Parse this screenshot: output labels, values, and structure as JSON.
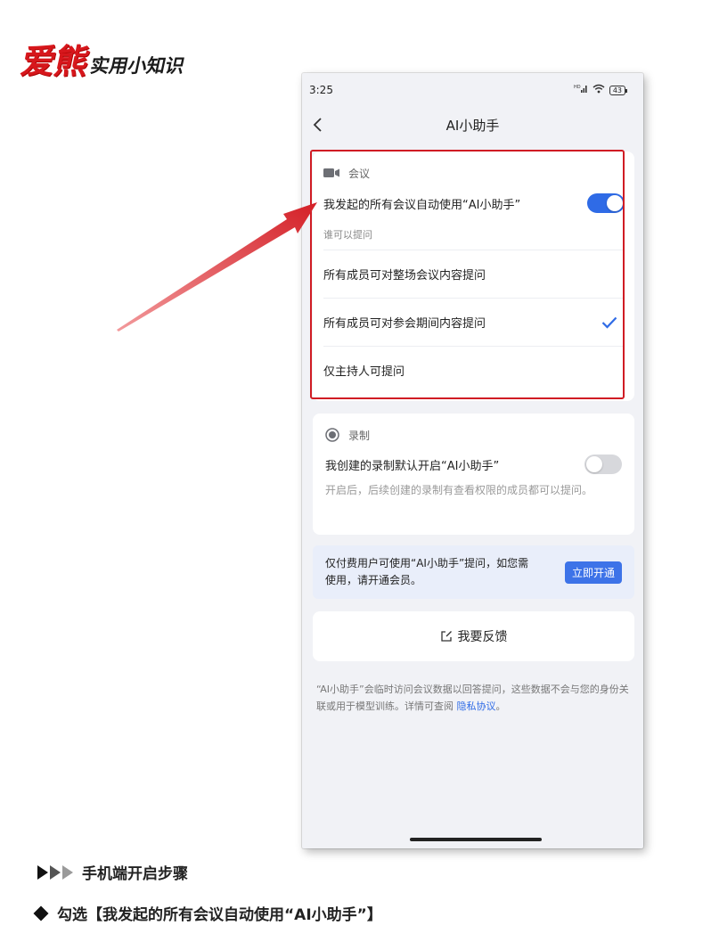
{
  "brand": {
    "main": "爱熊",
    "sub": "实用小知识",
    "accent": "#d7171c"
  },
  "phone": {
    "status_bar": {
      "time": "3:25",
      "signal_label": "HD",
      "battery": "43"
    },
    "nav": {
      "title": "AI小助手",
      "back_icon": "chevron-left-icon"
    },
    "meeting": {
      "section_label": "会议",
      "section_icon": "video-camera-icon",
      "toggle_label": "我发起的所有会议自动使用“AI小助手”",
      "toggle_on": true,
      "question_header": "谁可以提问",
      "options": [
        {
          "label": "所有成员可对整场会议内容提问",
          "selected": false
        },
        {
          "label": "所有成员可对参会期间内容提问",
          "selected": true
        },
        {
          "label": "仅主持人可提问",
          "selected": false
        }
      ],
      "check_icon": "checkmark-icon"
    },
    "recording": {
      "section_label": "录制",
      "section_icon": "record-icon",
      "toggle_label": "我创建的录制默认开启“AI小助手”",
      "toggle_on": false,
      "description": "开启后，后续创建的录制有查看权限的成员都可以提问。"
    },
    "membership": {
      "text": "仅付费用户可使用“AI小助手”提问，如您需使用，请开通会员。",
      "button_label": "立即开通"
    },
    "feedback": {
      "label": "我要反馈",
      "icon": "edit-icon"
    },
    "footnote": {
      "text": "“AI小助手”会临时访问会议数据以回答提问，这些数据不会与您的身份关联或用于模型训练。详情可查阅 ",
      "link": "隐私协议",
      "suffix": "。"
    },
    "colors": {
      "primary": "#2f6be6",
      "highlight_border": "#d01c24",
      "background": "#f1f2f6"
    }
  },
  "caption": {
    "steps_label": "手机端开启步骤",
    "instruction": "勾选【我发起的所有会议自动使用“AI小助手”】"
  },
  "annotation": {
    "arrow_color": "#d42027"
  }
}
